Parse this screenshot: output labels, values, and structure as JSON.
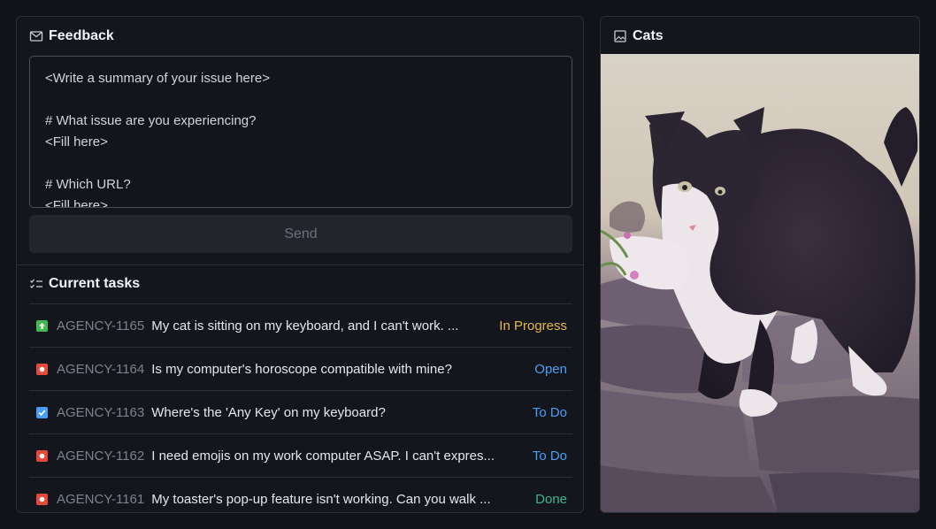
{
  "feedback": {
    "title": "Feedback",
    "textarea_value": "<Write a summary of your issue here>\n\n# What issue are you experiencing?\n<Fill here>\n\n# Which URL?\n<Fill here>",
    "send_label": "Send"
  },
  "tasks": {
    "title": "Current tasks",
    "items": [
      {
        "key": "AGENCY-1165",
        "title": "My cat is sitting on my keyboard, and I can't work. ...",
        "status": "In Progress",
        "status_color": "#e5b84a",
        "icon": "arrow-up-icon",
        "icon_color": "#3fb950"
      },
      {
        "key": "AGENCY-1164",
        "title": "Is my computer's horoscope compatible with mine?",
        "status": "Open",
        "status_color": "#4a9ff5",
        "icon": "bug-icon",
        "icon_color": "#e5493a"
      },
      {
        "key": "AGENCY-1163",
        "title": "Where's the 'Any Key' on my keyboard?",
        "status": "To Do",
        "status_color": "#4a9ff5",
        "icon": "checkbox-icon",
        "icon_color": "#4a9ff5"
      },
      {
        "key": "AGENCY-1162",
        "title": "I need emojis on my work computer ASAP. I can't expres...",
        "status": "To Do",
        "status_color": "#4a9ff5",
        "icon": "bug-icon",
        "icon_color": "#e5493a"
      },
      {
        "key": "AGENCY-1161",
        "title": "My toaster's pop-up feature isn't working. Can you walk ...",
        "status": "Done",
        "status_color": "#3fb68b",
        "icon": "bug-icon",
        "icon_color": "#e5493a"
      }
    ]
  },
  "cats": {
    "title": "Cats",
    "image_icon": "image-icon"
  }
}
